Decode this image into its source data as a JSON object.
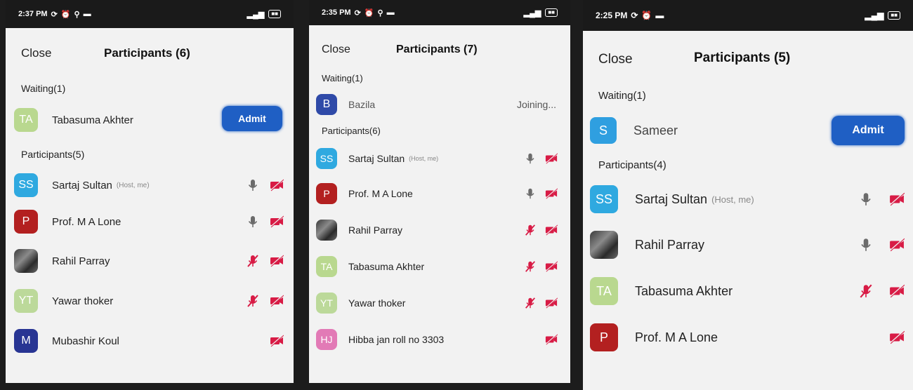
{
  "colors": {
    "accent": "#1f5fc4",
    "mute_red": "#d81b45",
    "mic_gray": "#6b6b6b"
  },
  "panels": [
    {
      "status": {
        "time": "2:37 PM"
      },
      "close_label": "Close",
      "title": "Participants (6)",
      "waiting_label": "Waiting(1)",
      "waiting": {
        "initials": "TA",
        "name": "Tabasuma Akhter",
        "action": "Admit"
      },
      "participants_label": "Participants(5)",
      "participants": [
        {
          "initials": "SS",
          "name": "Sartaj Sultan",
          "role": "(Host, me)",
          "mic": "on",
          "video": "off"
        },
        {
          "initials": "P",
          "name": "Prof. M A Lone",
          "mic": "on",
          "video": "off"
        },
        {
          "initials": "",
          "name": "Rahil Parray",
          "mic": "muted",
          "video": "off"
        },
        {
          "initials": "YT",
          "name": "Yawar thoker",
          "mic": "muted",
          "video": "off"
        },
        {
          "initials": "M",
          "name": "Mubashir Koul",
          "mic": "none",
          "video": "off"
        }
      ]
    },
    {
      "status": {
        "time": "2:35 PM"
      },
      "close_label": "Close",
      "title": "Participants (7)",
      "waiting_label": "Waiting(1)",
      "waiting": {
        "initials": "B",
        "name": "Bazila",
        "status": "Joining..."
      },
      "participants_label": "Participants(6)",
      "participants": [
        {
          "initials": "SS",
          "name": "Sartaj Sultan",
          "role": "(Host, me)",
          "mic": "on",
          "video": "off"
        },
        {
          "initials": "P",
          "name": "Prof. M A Lone",
          "mic": "on",
          "video": "off"
        },
        {
          "initials": "",
          "name": "Rahil Parray",
          "mic": "muted",
          "video": "off"
        },
        {
          "initials": "TA",
          "name": "Tabasuma Akhter",
          "mic": "muted",
          "video": "off"
        },
        {
          "initials": "YT",
          "name": "Yawar thoker",
          "mic": "muted",
          "video": "off"
        },
        {
          "initials": "HJ",
          "name": "Hibba jan roll no 3303",
          "mic": "none",
          "video": "off"
        }
      ]
    },
    {
      "status": {
        "time": "2:25 PM"
      },
      "close_label": "Close",
      "title": "Participants (5)",
      "waiting_label": "Waiting(1)",
      "waiting": {
        "initials": "S",
        "name": "Sameer",
        "action": "Admit"
      },
      "participants_label": "Participants(4)",
      "participants": [
        {
          "initials": "SS",
          "name": "Sartaj Sultan",
          "role": "(Host, me)",
          "mic": "on",
          "video": "off"
        },
        {
          "initials": "",
          "name": "Rahil Parray",
          "mic": "on",
          "video": "off"
        },
        {
          "initials": "TA",
          "name": "Tabasuma Akhter",
          "mic": "muted",
          "video": "off"
        },
        {
          "initials": "P",
          "name": "Prof. M A Lone",
          "mic": "none",
          "video": "off"
        }
      ]
    }
  ]
}
